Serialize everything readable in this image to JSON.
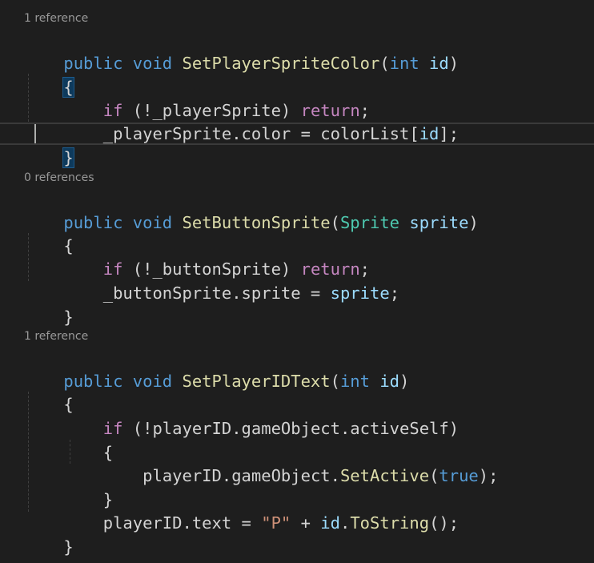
{
  "editor": {
    "theme_background": "#1e1e1e",
    "colors": {
      "keyword": "#569cd6",
      "control": "#c586c0",
      "function": "#dcdcaa",
      "parameter": "#9cdcfe",
      "type": "#4ec9b0",
      "string": "#ce9178",
      "plain": "#d4d4d4",
      "codelens": "#999999"
    }
  },
  "methods": [
    {
      "codelens": "1 reference",
      "modifiers": "public void",
      "name": "SetPlayerSpriteColor",
      "param_type": "int",
      "param_name": "id",
      "open_brace": "{",
      "close_brace": "}",
      "body": {
        "l1_ctl": "if",
        "l1_pre": "(!_playerSprite)",
        "l1_ret": "return",
        "l1_end": ";",
        "l2_pre": "_playerSprite.color = colorList[",
        "l2_prm": "id",
        "l2_end": "];"
      }
    },
    {
      "codelens": "0 references",
      "modifiers": "public void",
      "name": "SetButtonSprite",
      "param_type": "Sprite",
      "param_name": "sprite",
      "open_brace": "{",
      "close_brace": "}",
      "body": {
        "l1_ctl": "if",
        "l1_pre": "(!_buttonSprite)",
        "l1_ret": "return",
        "l1_end": ";",
        "l2_pre": "_buttonSprite.sprite = ",
        "l2_prm": "sprite",
        "l2_end": ";"
      }
    },
    {
      "codelens": "1 reference",
      "modifiers": "public void",
      "name": "SetPlayerIDText",
      "param_type": "int",
      "param_name": "id",
      "open_brace": "{",
      "close_brace": "}",
      "body": {
        "l1_ctl": "if",
        "l1_rest": "(!playerID.gameObject.activeSelf)",
        "inner_open": "{",
        "l2_pre": "playerID.gameObject.",
        "l2_fn": "SetActive",
        "l2_paren_open": "(",
        "l2_kw": "true",
        "l2_end": ");",
        "inner_close": "}",
        "l3_pre": "playerID.text = ",
        "l3_str": "\"P\"",
        "l3_plus": " + ",
        "l3_prm": "id",
        "l3_dot": ".",
        "l3_fn": "ToString",
        "l3_end": "();"
      }
    }
  ]
}
